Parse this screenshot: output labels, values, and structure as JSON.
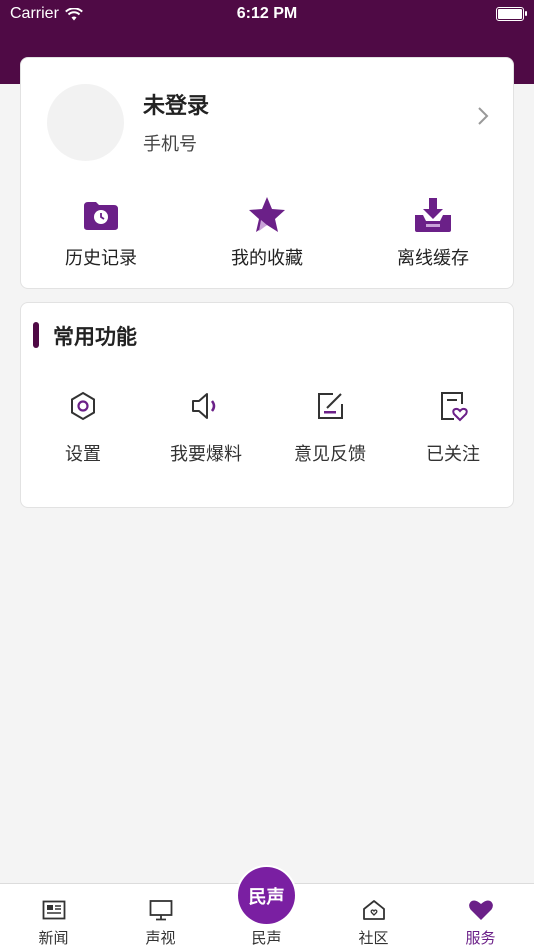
{
  "status_bar": {
    "carrier": "Carrier",
    "time": "6:12 PM"
  },
  "profile": {
    "name": "未登录",
    "phone": "手机号"
  },
  "quick_actions": [
    {
      "label": "历史记录",
      "icon": "history-folder-icon"
    },
    {
      "label": "我的收藏",
      "icon": "star-icon"
    },
    {
      "label": "离线缓存",
      "icon": "download-tray-icon"
    }
  ],
  "functions": {
    "title": "常用功能",
    "items": [
      {
        "label": "设置",
        "icon": "settings-hexagon-icon"
      },
      {
        "label": "我要爆料",
        "icon": "speaker-icon"
      },
      {
        "label": "意见反馈",
        "icon": "edit-icon"
      },
      {
        "label": "已关注",
        "icon": "followed-heart-icon"
      }
    ]
  },
  "tabbar": {
    "items": [
      {
        "label": "新闻",
        "icon": "news-icon"
      },
      {
        "label": "声视",
        "icon": "tv-icon"
      },
      {
        "label": "民声",
        "icon": "minsheng-logo-icon"
      },
      {
        "label": "社区",
        "icon": "community-house-icon"
      },
      {
        "label": "服务",
        "icon": "heart-icon",
        "active": true
      }
    ],
    "center_logo_text": "民声"
  },
  "colors": {
    "brand": "#4f0a45",
    "accent_purple": "#6b2088",
    "background": "#f4f4f4"
  }
}
